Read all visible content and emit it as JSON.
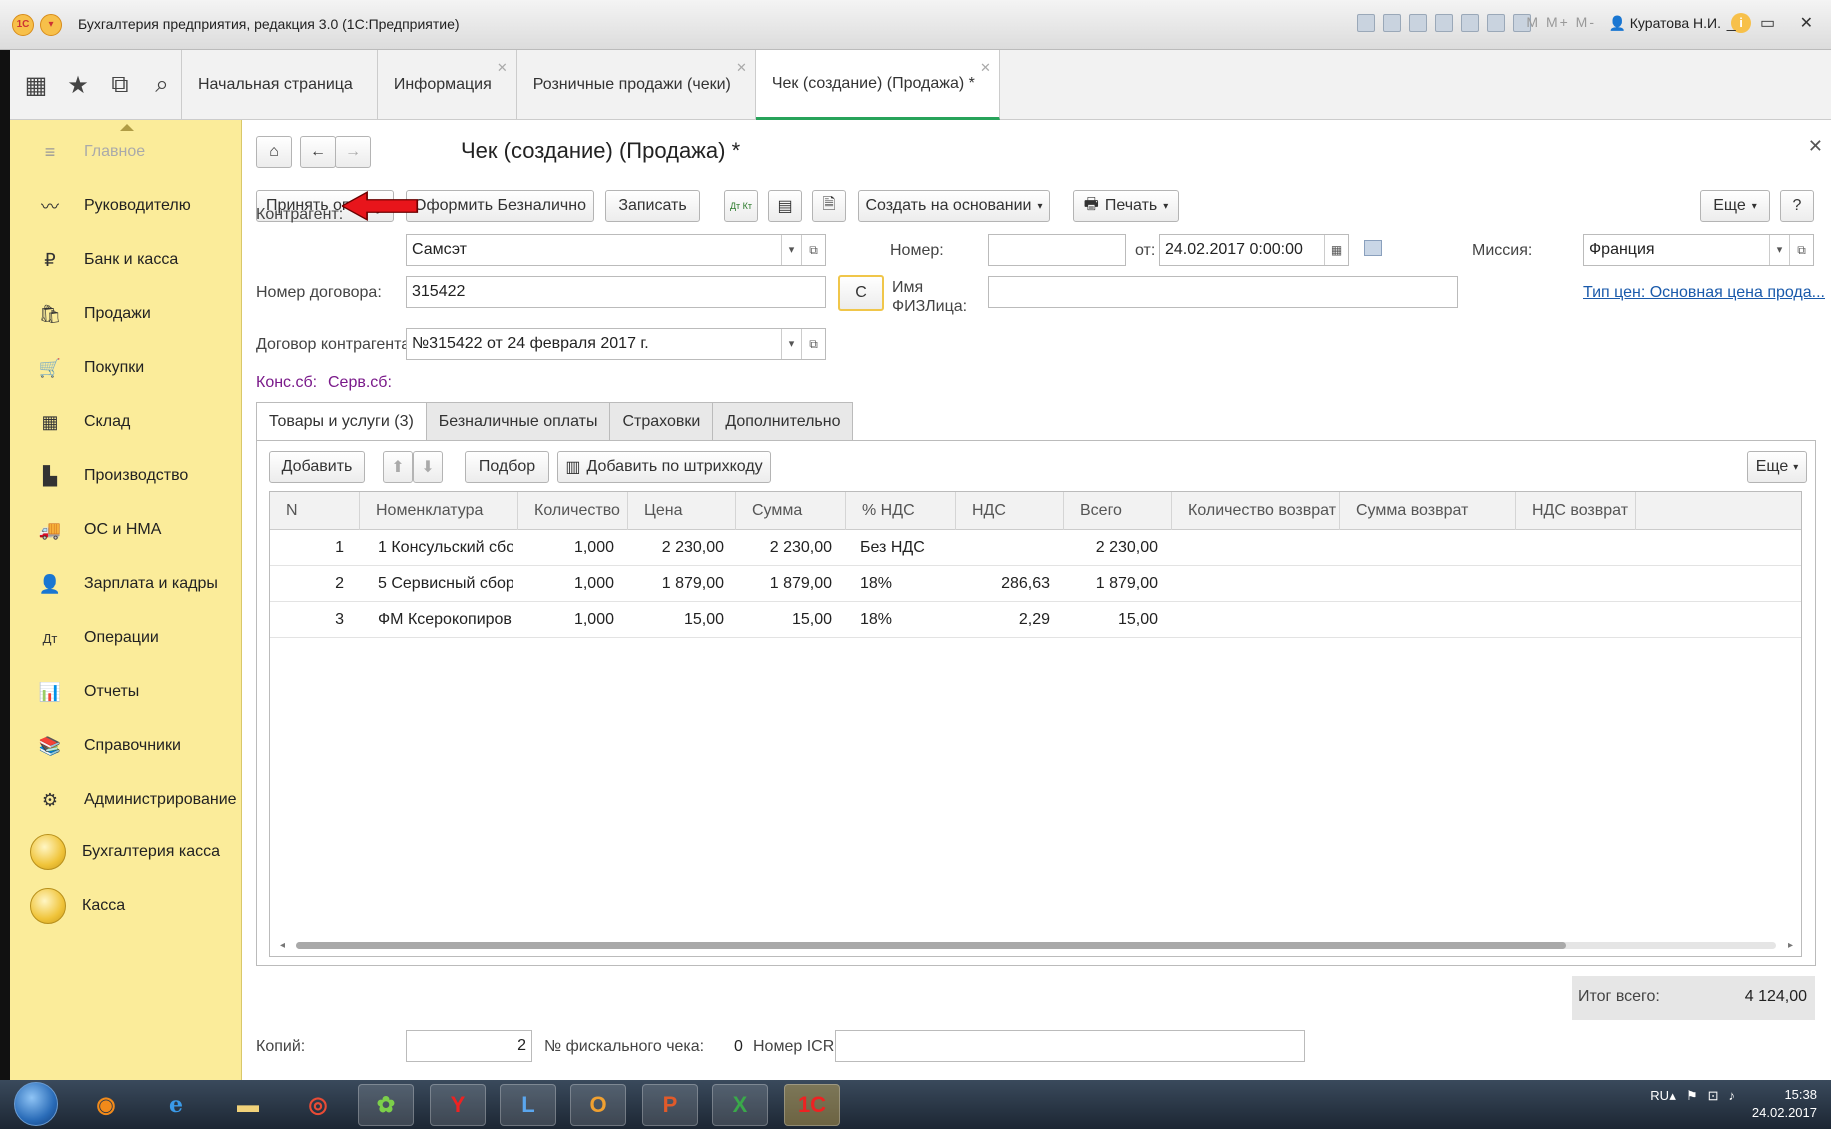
{
  "window": {
    "title": "Бухгалтерия предприятия, редакция 3.0 (1С:Предприятие)",
    "memory": "M M+ M-",
    "user": "Куратова Н.И.",
    "controls": "_ ▭ ✕"
  },
  "tabs": [
    {
      "label": "Начальная страница",
      "closable": false
    },
    {
      "label": "Информация",
      "closable": true
    },
    {
      "label": "Розничные продажи (чеки)",
      "closable": true
    },
    {
      "label": "Чек (создание) (Продажа) *",
      "closable": true,
      "active": true
    }
  ],
  "sidebar": {
    "items": [
      {
        "label": "Главное",
        "icon": "menu-lines-icon"
      },
      {
        "label": "Руководителю",
        "icon": "trend-icon"
      },
      {
        "label": "Банк и касса",
        "icon": "ruble-coin-icon"
      },
      {
        "label": "Продажи",
        "icon": "shopping-bag-icon"
      },
      {
        "label": "Покупки",
        "icon": "cart-icon"
      },
      {
        "label": "Склад",
        "icon": "warehouse-icon"
      },
      {
        "label": "Производство",
        "icon": "factory-icon"
      },
      {
        "label": "ОС и НМА",
        "icon": "truck-icon"
      },
      {
        "label": "Зарплата и кадры",
        "icon": "person-icon"
      },
      {
        "label": "Операции",
        "icon": "dt-kt-icon"
      },
      {
        "label": "Отчеты",
        "icon": "bar-chart-icon"
      },
      {
        "label": "Справочники",
        "icon": "books-icon"
      },
      {
        "label": "Администрирование",
        "icon": "gear-icon"
      },
      {
        "label": "Бухгалтерия касса",
        "icon": "coin-icon"
      },
      {
        "label": "Касса",
        "icon": "coin-icon"
      }
    ]
  },
  "form": {
    "title": "Чек (создание) (Продажа) *",
    "buttons": {
      "accept_payment": "Принять оплату",
      "cashless": "Оформить Безналично",
      "save": "Записать",
      "create_based": "Создать на основании",
      "print": "Печать",
      "more": "Еще",
      "help": "?",
      "c": "С",
      "dt_kt": "Дт Кт"
    },
    "labels": {
      "counterparty": "Контрагент:",
      "number": "Номер:",
      "from": "от:",
      "mission": "Миссия:",
      "contract_number": "Номер договора:",
      "person_name": "Имя ФИЗЛица:",
      "contract": "Договор контрагента:",
      "kons": "Конс.сб:",
      "serv": "Серв.сб:",
      "copies": "Копий:",
      "fiscal_no": "№ фискального чека:",
      "icr": "Номер ICR:",
      "total": "Итог всего:"
    },
    "values": {
      "counterparty": "Самсэт",
      "number": "",
      "date": "24.02.2017  0:00:00",
      "mission": "Франция",
      "contract_number": "315422",
      "person_name": "",
      "contract": "№315422 от 24 февраля 2017 г.",
      "copies": "2",
      "fiscal_no": "0",
      "icr": "",
      "total": "4 124,00"
    },
    "price_type_link": "Тип цен: Основная цена прода..."
  },
  "form_tabs": [
    {
      "label": "Товары и услуги (3)",
      "active": true
    },
    {
      "label": "Безналичные оплаты"
    },
    {
      "label": "Страховки"
    },
    {
      "label": "Дополнительно"
    }
  ],
  "table_toolbar": {
    "add": "Добавить",
    "pick": "Подбор",
    "add_barcode": "Добавить по штрихкоду",
    "more": "Еще"
  },
  "table": {
    "columns": [
      "N",
      "Номенклатура",
      "Количество",
      "Цена",
      "Сумма",
      "% НДС",
      "НДС",
      "Всего",
      "Количество возврат",
      "Сумма возврат",
      "НДС возврат"
    ],
    "rows": [
      [
        "1",
        "1 Консульский сбо...",
        "1,000",
        "2 230,00",
        "2 230,00",
        "Без НДС",
        "",
        "2 230,00"
      ],
      [
        "2",
        "5 Сервисный сбор...",
        "1,000",
        "1 879,00",
        "1 879,00",
        "18%",
        "286,63",
        "1 879,00"
      ],
      [
        "3",
        "ФМ Ксерокопиров...",
        "1,000",
        "15,00",
        "15,00",
        "18%",
        "2,29",
        "15,00"
      ]
    ]
  },
  "taskbar": {
    "lang": "RU",
    "time": "15:38",
    "date": "24.02.2017"
  },
  "colors": {
    "sidebar": "#fbec9a",
    "active_tab_underline": "#27a35a",
    "link": "#1a5aab",
    "arrow": "#e8151b"
  }
}
